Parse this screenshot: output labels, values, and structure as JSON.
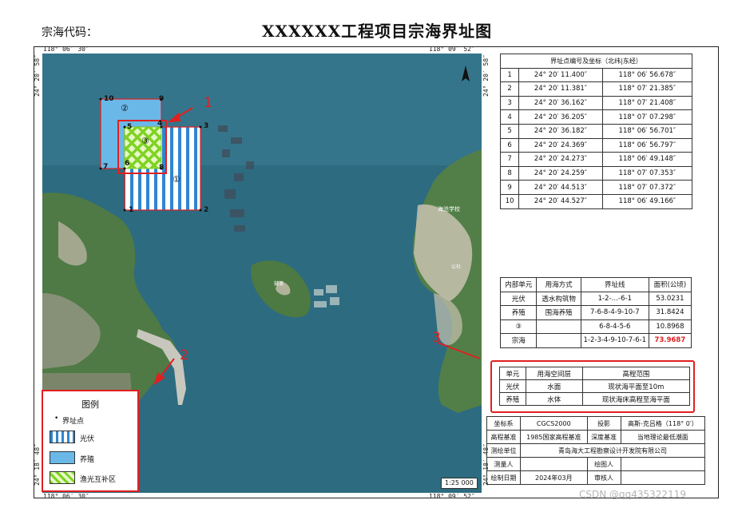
{
  "header": {
    "code_label": "宗海代码：",
    "title": "XXXXXX工程项目宗海界址图"
  },
  "map": {
    "coords": {
      "top_left": "118° 06′ 30″",
      "top_right": "118° 09′ 52″",
      "bottom_left": "118° 06′ 30″",
      "bottom_right": "118° 09′ 52″",
      "left_top": "24° 20′ 58″",
      "left_bottom": "24° 18′ 48″",
      "right_top": "24° 20′ 58″",
      "right_bottom": "24° 18′ 48″"
    },
    "point_labels": [
      "1",
      "2",
      "3",
      "4",
      "5",
      "6",
      "7",
      "8",
      "9",
      "10"
    ],
    "zone_labels": {
      "pv": "①",
      "farm": "②",
      "overlap": "③"
    },
    "place_labels": [
      "海沧学校",
      "鼓浪",
      "公社"
    ],
    "scale": "1:25 000",
    "annotations": [
      "1",
      "2",
      "3"
    ],
    "colors": {
      "sea": "#2f6f86",
      "farm": "#6ab8e8",
      "pv_stripe": "#2e86d1",
      "overlap": "#7ed321",
      "boundary": "#e02020"
    }
  },
  "legend": {
    "title": "图例",
    "items": [
      {
        "label": "界址点",
        "icon": "boundary-point-icon"
      },
      {
        "label": "光伏",
        "icon": "pv-stripe-swatch"
      },
      {
        "label": "养殖",
        "icon": "farm-fill-swatch"
      },
      {
        "label": "渔光互补区",
        "icon": "overlap-hatch-swatch"
      }
    ]
  },
  "point_table": {
    "header": "界址点编号及坐标（北纬|东经）",
    "rows": [
      [
        "1",
        "24° 20′ 11.400″",
        "118° 06′ 56.678″"
      ],
      [
        "2",
        "24° 20′ 11.381″",
        "118° 07′ 21.385″"
      ],
      [
        "3",
        "24° 20′ 36.162″",
        "118° 07′ 21.408″"
      ],
      [
        "4",
        "24° 20′ 36.205″",
        "118° 07′ 07.298″"
      ],
      [
        "5",
        "24° 20′ 36.182″",
        "118° 06′ 56.701″"
      ],
      [
        "6",
        "24° 20′ 24.369″",
        "118° 06′ 56.797″"
      ],
      [
        "7",
        "24° 20′ 24.273″",
        "118° 06′ 49.148″"
      ],
      [
        "8",
        "24° 20′ 24.259″",
        "118° 07′ 07.353″"
      ],
      [
        "9",
        "24° 20′ 44.513″",
        "118° 07′ 07.372″"
      ],
      [
        "10",
        "24° 20′ 44.527″",
        "118° 06′ 49.166″"
      ]
    ]
  },
  "unit_table": {
    "headers": [
      "内部单元",
      "用海方式",
      "界址线",
      "面积(公顷)"
    ],
    "rows": [
      [
        "光伏",
        "透水构筑物",
        "1-2-…-6-1",
        "53.0231"
      ],
      [
        "养殖",
        "围海养殖",
        "7-6-8-4-9-10-7",
        "31.8424"
      ],
      [
        "③",
        "",
        "6-8-4-5-6",
        "10.8968"
      ],
      [
        "宗海",
        "",
        "1-2-3-4-9-10-7-6-1",
        "73.9687"
      ]
    ],
    "total_color": "#e02020"
  },
  "height_table": {
    "headers": [
      "单元",
      "用海空间层",
      "高程范围"
    ],
    "rows": [
      [
        "光伏",
        "水面",
        "现状海平面至10m"
      ],
      [
        "养殖",
        "水体",
        "现状海床高程至海平面"
      ]
    ]
  },
  "info_table": {
    "coord_system_label": "坐标系",
    "coord_system": "CGCS2000",
    "projection_label": "投影",
    "projection": "高斯-克吕格（118° 0′）",
    "height_datum_label": "高程基准",
    "height_datum": "1985国家高程基准",
    "depth_datum_label": "深度基准",
    "depth_datum": "当地理论最低潮面",
    "survey_unit_label": "测绘单位",
    "survey_unit": "青岛海大工程勘察设计开发院有限公司",
    "surveyor_label": "测量人",
    "surveyor": "",
    "drafter_label": "绘图人",
    "drafter": "",
    "date_label": "绘制日期",
    "date": "2024年03月",
    "reviewer_label": "审核人",
    "reviewer": ""
  },
  "watermark": "CSDN @qq435322119"
}
